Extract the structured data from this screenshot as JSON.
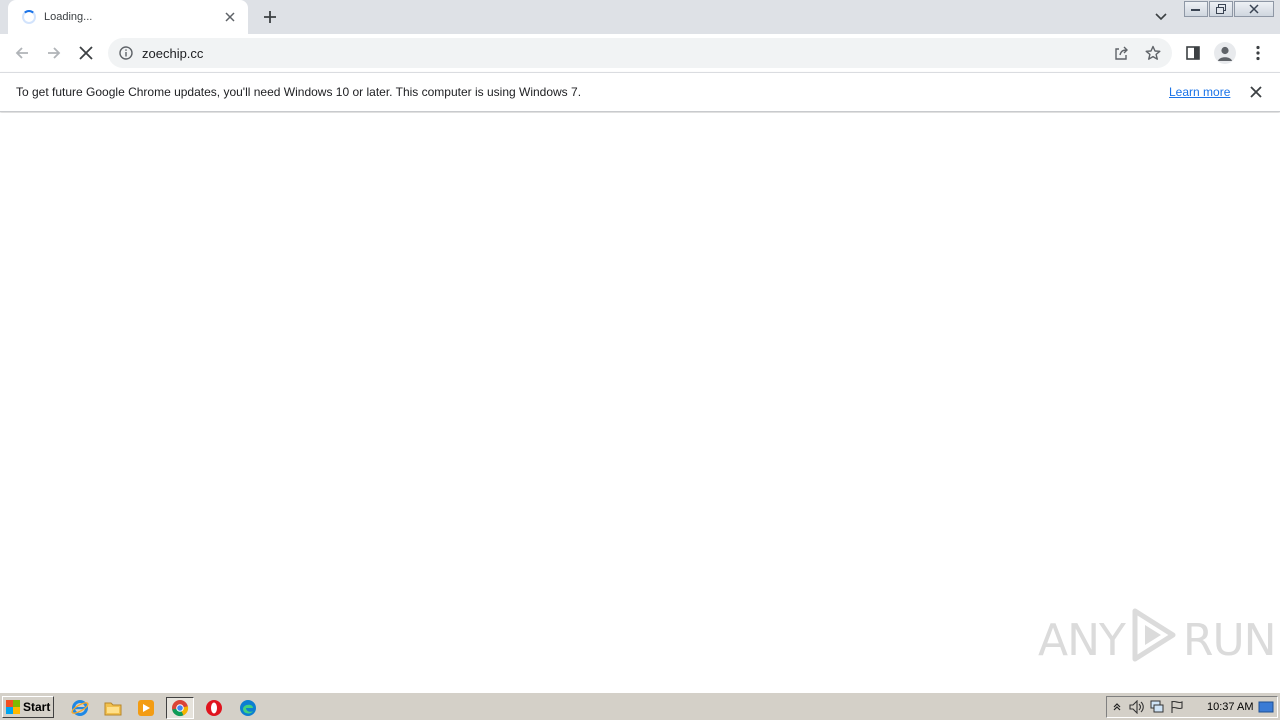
{
  "tab": {
    "title": "Loading..."
  },
  "address_bar": {
    "url": "zoechip.cc"
  },
  "infobar": {
    "message": "To get future Google Chrome updates, you'll need Windows 10 or later. This computer is using Windows 7.",
    "link_label": "Learn more"
  },
  "watermark": {
    "left": "ANY",
    "right": "RUN"
  },
  "taskbar": {
    "start_label": "Start",
    "clock": "10:37 AM",
    "apps": [
      "internet-explorer",
      "file-explorer",
      "media-player",
      "chrome",
      "opera",
      "edge"
    ]
  },
  "colors": {
    "tabstrip": "#dee1e6",
    "accent": "#1a73e8",
    "taskbar": "#d4d0c8"
  }
}
